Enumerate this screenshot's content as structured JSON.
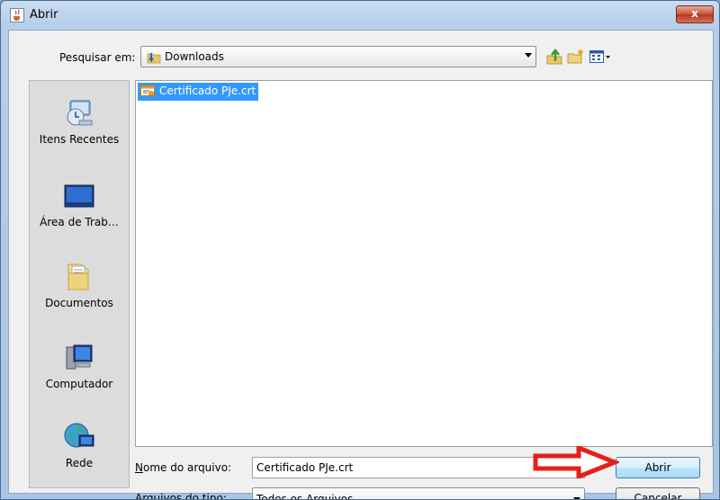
{
  "window": {
    "title": "Abrir",
    "close_glyph": "x"
  },
  "toolbar": {
    "look_in_label": "Pesquisar em:",
    "look_in_value": "Downloads",
    "icons": [
      "up-folder-icon",
      "new-folder-icon",
      "view-menu-icon"
    ]
  },
  "places": [
    {
      "label": "Itens Recentes",
      "icon": "recent-items-icon"
    },
    {
      "label": "Área de Trab…",
      "icon": "desktop-icon"
    },
    {
      "label": "Documentos",
      "icon": "documents-icon"
    },
    {
      "label": "Computador",
      "icon": "computer-icon"
    },
    {
      "label": "Rede",
      "icon": "network-icon"
    }
  ],
  "files": [
    {
      "name": "Certificado PJe.crt",
      "icon": "certificate-file-icon",
      "selected": true
    }
  ],
  "form": {
    "filename_label_u": "N",
    "filename_label_rest": "ome do arquivo:",
    "filename_value": "Certificado PJe.crt",
    "filetype_label_pre": "Arquivos do ",
    "filetype_label_u": "t",
    "filetype_label_rest": "ipo:",
    "filetype_value": "Todos os Arquivos"
  },
  "buttons": {
    "open": "Abrir",
    "cancel": "Cancelar"
  },
  "colors": {
    "selection": "#3399ff",
    "annotation_arrow": "#e3201b"
  }
}
